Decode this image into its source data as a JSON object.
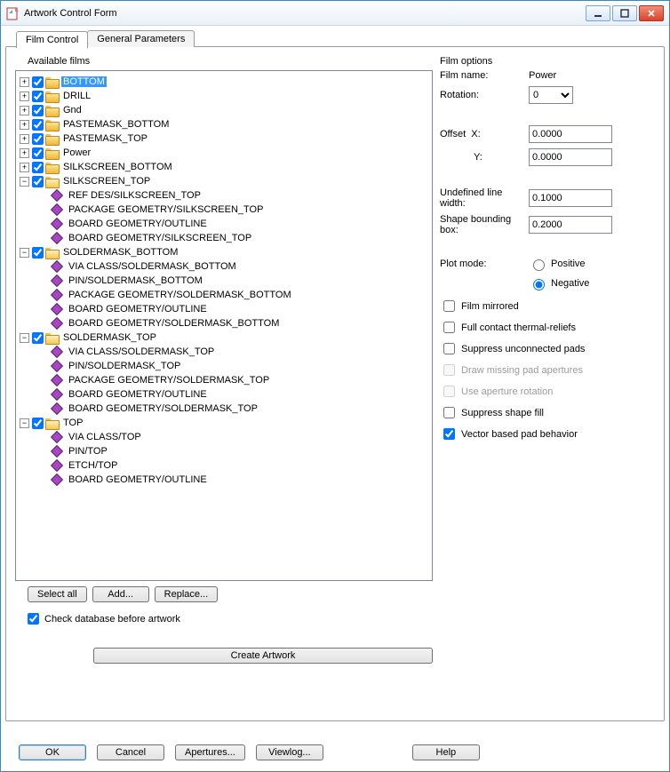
{
  "window": {
    "title": "Artwork Control Form"
  },
  "tabs": {
    "film_control": "Film Control",
    "general_parameters": "General Parameters"
  },
  "tree": {
    "group_label": "Available films",
    "nodes": [
      {
        "type": "folder",
        "expand": "plus",
        "checked": true,
        "open": false,
        "label": "BOTTOM",
        "selected": true
      },
      {
        "type": "folder",
        "expand": "plus",
        "checked": true,
        "open": false,
        "label": "DRILL"
      },
      {
        "type": "folder",
        "expand": "plus",
        "checked": true,
        "open": false,
        "label": "Gnd"
      },
      {
        "type": "folder",
        "expand": "plus",
        "checked": true,
        "open": false,
        "label": "PASTEMASK_BOTTOM"
      },
      {
        "type": "folder",
        "expand": "plus",
        "checked": true,
        "open": false,
        "label": "PASTEMASK_TOP"
      },
      {
        "type": "folder",
        "expand": "plus",
        "checked": true,
        "open": false,
        "label": "Power"
      },
      {
        "type": "folder",
        "expand": "plus",
        "checked": true,
        "open": false,
        "label": "SILKSCREEN_BOTTOM"
      },
      {
        "type": "folder",
        "expand": "minus",
        "checked": true,
        "open": true,
        "label": "SILKSCREEN_TOP",
        "children": [
          "REF DES/SILKSCREEN_TOP",
          "PACKAGE GEOMETRY/SILKSCREEN_TOP",
          "BOARD GEOMETRY/OUTLINE",
          "BOARD GEOMETRY/SILKSCREEN_TOP"
        ]
      },
      {
        "type": "folder",
        "expand": "minus",
        "checked": true,
        "open": true,
        "label": "SOLDERMASK_BOTTOM",
        "children": [
          "VIA CLASS/SOLDERMASK_BOTTOM",
          "PIN/SOLDERMASK_BOTTOM",
          "PACKAGE GEOMETRY/SOLDERMASK_BOTTOM",
          "BOARD GEOMETRY/OUTLINE",
          "BOARD GEOMETRY/SOLDERMASK_BOTTOM"
        ]
      },
      {
        "type": "folder",
        "expand": "minus",
        "checked": true,
        "open": true,
        "label": "SOLDERMASK_TOP",
        "children": [
          "VIA CLASS/SOLDERMASK_TOP",
          "PIN/SOLDERMASK_TOP",
          "PACKAGE GEOMETRY/SOLDERMASK_TOP",
          "BOARD GEOMETRY/OUTLINE",
          "BOARD GEOMETRY/SOLDERMASK_TOP"
        ]
      },
      {
        "type": "folder",
        "expand": "minus",
        "checked": true,
        "open": true,
        "label": "TOP",
        "children": [
          "VIA CLASS/TOP",
          "PIN/TOP",
          "ETCH/TOP",
          "BOARD GEOMETRY/OUTLINE"
        ]
      }
    ]
  },
  "buttons": {
    "select_all": "Select all",
    "add": "Add...",
    "replace": "Replace...",
    "create_artwork": "Create Artwork"
  },
  "check_db": {
    "label": "Check database before artwork",
    "checked": true
  },
  "options": {
    "group_label": "Film options",
    "film_name_label": "Film name:",
    "film_name": "Power",
    "rotation_label": "Rotation:",
    "rotation": "0",
    "offset_label": "Offset",
    "x_label": "X:",
    "x": "0.0000",
    "y_label": "Y:",
    "y": "0.0000",
    "undef_lw_label": "Undefined line width:",
    "undef_lw": "0.1000",
    "shape_box_label": "Shape bounding box:",
    "shape_box": "0.2000",
    "plot_mode_label": "Plot mode:",
    "positive": "Positive",
    "negative": "Negative",
    "plot_mode_value": "negative",
    "checks": [
      {
        "label": "Film mirrored",
        "checked": false,
        "disabled": false
      },
      {
        "label": "Full contact thermal-reliefs",
        "checked": false,
        "disabled": false
      },
      {
        "label": "Suppress unconnected pads",
        "checked": false,
        "disabled": false
      },
      {
        "label": "Draw missing pad apertures",
        "checked": false,
        "disabled": true
      },
      {
        "label": "Use aperture rotation",
        "checked": false,
        "disabled": true
      },
      {
        "label": "Suppress shape fill",
        "checked": false,
        "disabled": false
      },
      {
        "label": "Vector based pad behavior",
        "checked": true,
        "disabled": false
      }
    ]
  },
  "bottom": {
    "ok": "OK",
    "cancel": "Cancel",
    "apertures": "Apertures...",
    "viewlog": "Viewlog...",
    "help": "Help"
  }
}
